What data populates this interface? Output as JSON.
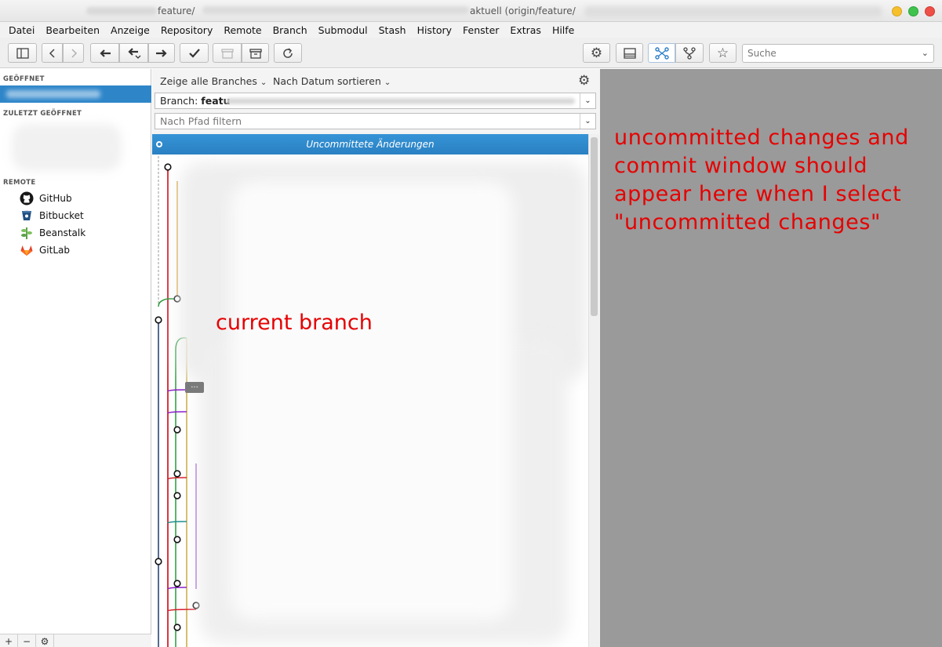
{
  "window": {
    "title_part1": "feature/",
    "title_part2": "aktuell (origin/feature/"
  },
  "menu": [
    "Datei",
    "Bearbeiten",
    "Anzeige",
    "Repository",
    "Remote",
    "Branch",
    "Submodul",
    "Stash",
    "History",
    "Fenster",
    "Extras",
    "Hilfe"
  ],
  "search": {
    "placeholder": "Suche"
  },
  "sidebar": {
    "opened_header": "GEÖFFNET",
    "recent_header": "ZULETZT GEÖFFNET",
    "remote_header": "REMOTE",
    "remotes": [
      {
        "label": "GitHub",
        "icon": "github-icon"
      },
      {
        "label": "Bitbucket",
        "icon": "bitbucket-icon"
      },
      {
        "label": "Beanstalk",
        "icon": "beanstalk-icon"
      },
      {
        "label": "GitLab",
        "icon": "gitlab-icon"
      }
    ],
    "footer": {
      "add": "+",
      "remove": "−",
      "settings": "⚙"
    }
  },
  "log": {
    "show_branches": "Zeige alle Branches",
    "sort": "Nach Datum sortieren",
    "branch_label": "Branch:",
    "branch_value": "featu",
    "path_filter_placeholder": "Nach Pfad filtern",
    "uncommitted_row": "Uncommittete Änderungen",
    "more_tag": "..."
  },
  "annotations": {
    "current_branch": "current branch",
    "right_note": "uncommitted changes and commit window should appear here when I select \"uncommitted changes\""
  },
  "colors": {
    "selection": "#2e86c9",
    "annotation": "#e60000",
    "right_panel": "#9a9a9a"
  }
}
